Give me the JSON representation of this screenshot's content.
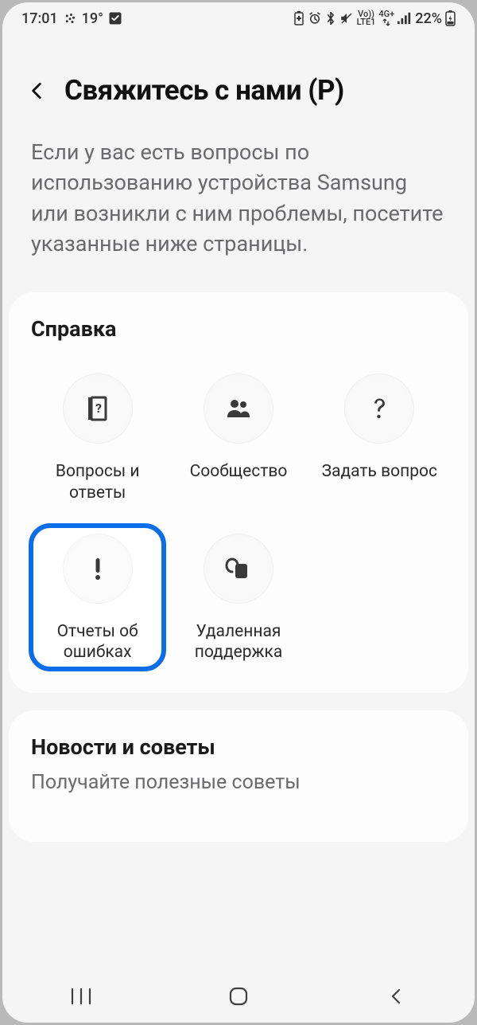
{
  "statusbar": {
    "time": "17:01",
    "temp": "19°",
    "lte_top": "Vo))",
    "lte_bot": "LTE1",
    "sig": "4G+",
    "battery": "22%"
  },
  "header": {
    "title": "Свяжитесь с нами (P)"
  },
  "intro": "Если у вас есть вопросы по использованию устройства Samsung или возникли с ним проблемы, посетите указанные ниже страницы.",
  "help": {
    "title": "Справка",
    "items": [
      {
        "label": "Вопросы и ответы"
      },
      {
        "label": "Сообщество"
      },
      {
        "label": "Задать вопрос"
      },
      {
        "label": "Отчеты об ошибках"
      },
      {
        "label": "Удаленная поддержка"
      }
    ]
  },
  "news": {
    "title": "Новости и советы",
    "sub": "Получайте полезные советы"
  },
  "colors": {
    "highlight": "#0a6ee8"
  }
}
